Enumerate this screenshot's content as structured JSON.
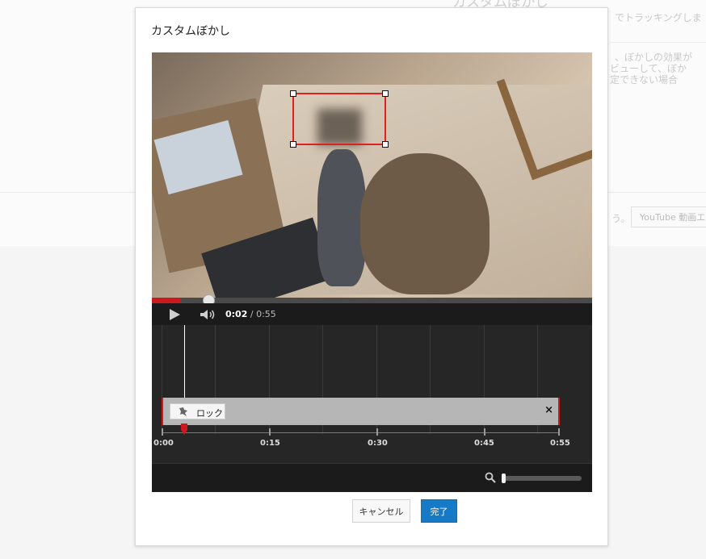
{
  "background": {
    "title": "カスタムぼかし",
    "text_line1": "でトラッキングしま",
    "text_line2": "、ぼかしの効果が",
    "text_line3": "ビューして、ぼか",
    "text_line4": "定できない場合",
    "text_line5": "う。",
    "editor_button": "YouTube 動画エ"
  },
  "dialog": {
    "title": "カスタムぼかし"
  },
  "player": {
    "current_time": "0:02",
    "separator": " / ",
    "duration": "0:55",
    "progress_fraction": 0.064
  },
  "timeline": {
    "tick_labels": [
      "0:00",
      "0:15",
      "0:30",
      "0:45",
      "0:55"
    ],
    "blur_track": {
      "lock_label": "ロック",
      "close_glyph": "×"
    }
  },
  "zoom": {
    "level_fraction": 0.0
  },
  "buttons": {
    "cancel": "キャンセル",
    "done": "完了"
  },
  "colors": {
    "accent_red": "#cc181e",
    "primary_blue": "#167ac6",
    "timeline_bg": "#262626"
  }
}
